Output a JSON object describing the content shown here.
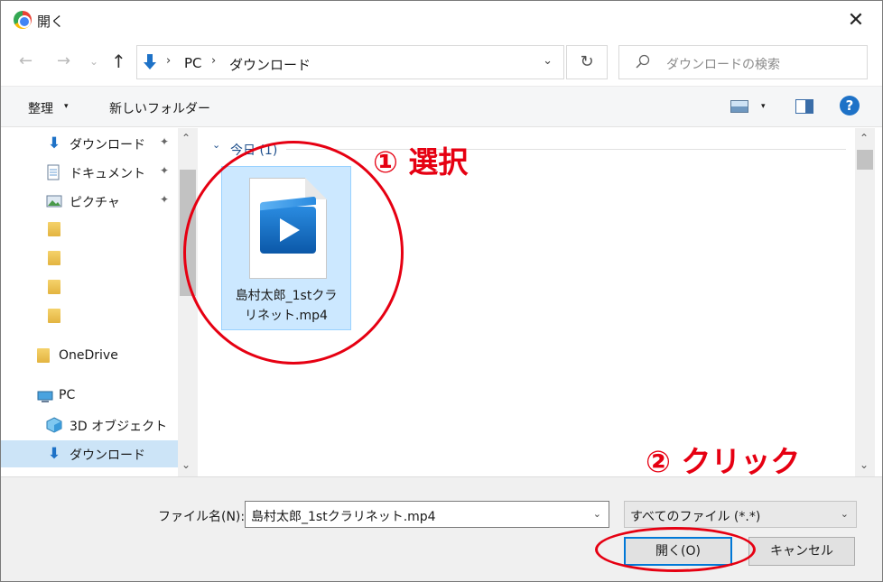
{
  "window": {
    "title": "開く",
    "close_glyph": "✕"
  },
  "nav": {
    "back_glyph": "←",
    "forward_glyph": "→",
    "recent_glyph": "⌄",
    "up_glyph": "↑",
    "address_segments": [
      "PC",
      "ダウンロード"
    ],
    "address_sep": "›",
    "dropdown_glyph": "⌄",
    "refresh_glyph": "↻",
    "search_placeholder": "ダウンロードの検索"
  },
  "toolbar": {
    "organize_label": "整理",
    "caret": "▾",
    "new_folder_label": "新しいフォルダー",
    "help_glyph": "?"
  },
  "sidebar": {
    "pin_glyph": "📌",
    "items": [
      {
        "label": "ダウンロード",
        "icon": "download-arrow-icon",
        "pinned": true
      },
      {
        "label": "ドキュメント",
        "icon": "documents-icon",
        "pinned": true
      },
      {
        "label": "ピクチャ",
        "icon": "pictures-icon",
        "pinned": true
      },
      {
        "label": "",
        "icon": "folder-icon"
      },
      {
        "label": "",
        "icon": "folder-icon"
      },
      {
        "label": "",
        "icon": "folder-icon"
      },
      {
        "label": "",
        "icon": "folder-icon"
      },
      {
        "label": "OneDrive",
        "icon": "onedrive-folder-icon"
      },
      {
        "label": "PC",
        "icon": "pc-icon"
      },
      {
        "label": "3D オブジェクト",
        "icon": "3d-objects-icon"
      },
      {
        "label": "ダウンロード",
        "icon": "download-arrow-icon",
        "selected": true
      }
    ],
    "scroll_up": "⌃",
    "scroll_down": "⌄"
  },
  "files": {
    "group_label": "今日 (1)",
    "group_caret": "⌄",
    "items": [
      {
        "name_line1": "島村太郎_1stクラ",
        "name_line2": "リネット.mp4",
        "icon": "video-file-icon",
        "selected": true
      }
    ]
  },
  "bottom": {
    "filename_label": "ファイル名(N):",
    "filename_value": "島村太郎_1stクラリネット.mp4",
    "filetype_value": "すべてのファイル (*.*)",
    "caret": "⌄",
    "open_label": "開く(O)",
    "cancel_label": "キャンセル"
  },
  "annotations": {
    "step1": "① 選択",
    "step2": "② クリック",
    "color": "#e60012"
  },
  "colors": {
    "selection": "#cce8ff",
    "accent": "#0078d7",
    "help": "#1e72c7"
  }
}
